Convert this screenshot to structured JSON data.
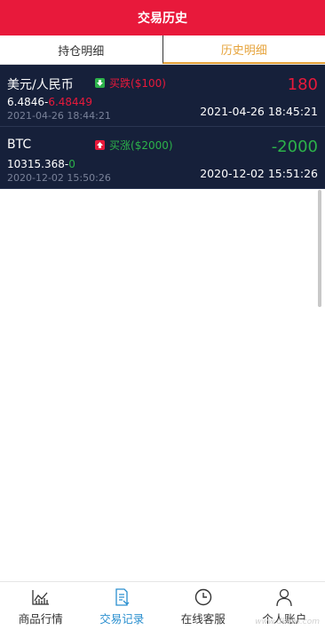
{
  "header": {
    "title": "交易历史"
  },
  "tabs": [
    {
      "label": "持仓明细",
      "active": false
    },
    {
      "label": "历史明细",
      "active": true
    }
  ],
  "trades": [
    {
      "name": "美元/人民币",
      "direction_icon": "arrow-down-icon",
      "direction": "买跌",
      "stake": "($100)",
      "open_price": "6.4846-",
      "close_price": "6.48449",
      "open_time": "2021-04-26 18:44:21",
      "profit": "180",
      "close_time": "2021-04-26 18:45:21"
    },
    {
      "name": "BTC",
      "direction_icon": "arrow-up-icon",
      "direction": "买涨",
      "stake": "($2000)",
      "open_price": "10315.368-",
      "close_price": "0",
      "open_time": "2020-12-02 15:50:26",
      "profit": "-2000",
      "close_time": "2020-12-02 15:51:26"
    }
  ],
  "bottom_nav": [
    {
      "label": "商品行情",
      "icon": "market-chart-icon"
    },
    {
      "label": "交易记录",
      "icon": "trade-record-icon",
      "active": true
    },
    {
      "label": "在线客服",
      "icon": "clock-icon"
    },
    {
      "label": "个人账户",
      "icon": "user-icon"
    }
  ],
  "watermark": "www.dkewl.com",
  "colors": {
    "brand_red": "#e8193b",
    "list_bg": "#16203a",
    "rise_green": "#2cb24a",
    "tab_active": "#e6a33a",
    "nav_active": "#2a8fcf"
  }
}
